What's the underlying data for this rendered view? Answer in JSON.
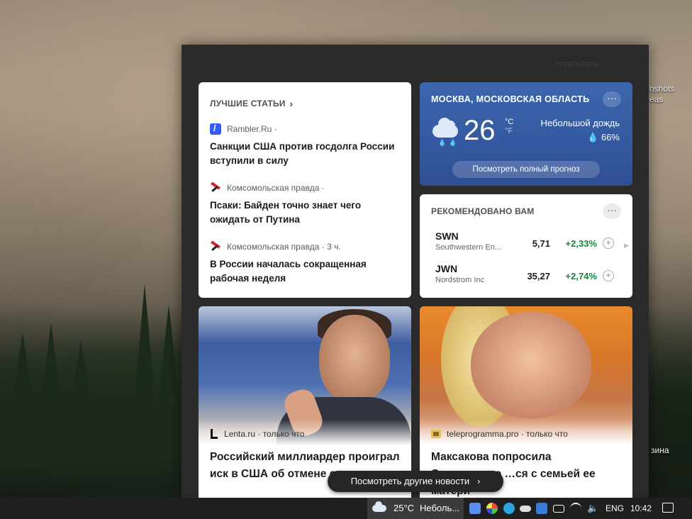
{
  "desktop": {
    "icon1_label": "nshots\neas",
    "icon2_label": "зина"
  },
  "panel": {
    "top_right_text": "Управлять"
  },
  "top_stories": {
    "title": "ЛУЧШИЕ СТАТЬИ",
    "items": [
      {
        "source": "Rambler.Ru ·",
        "headline": "Санкции США против госдолга России вступили в силу",
        "icon": "rambler-logo-icon"
      },
      {
        "source": "Комсомольская правда ·",
        "headline": "Псаки: Байден точно знает чего ожидать от Путина",
        "icon": "kp-logo-icon"
      },
      {
        "source": "Комсомольская правда · 3 ч.",
        "headline": "В России началась сокращенная рабочая неделя",
        "icon": "kp-logo-icon"
      }
    ]
  },
  "weather": {
    "location": "МОСКВА, МОСКОВСКАЯ ОБЛАСТЬ",
    "more": "···",
    "temp": "26",
    "unit_c": "°C",
    "unit_f": "°F",
    "condition": "Небольшой дождь",
    "precip": "💧 66%",
    "forecast_button": "Посмотреть полный прогноз",
    "icon": "rain-cloud-icon"
  },
  "stocks": {
    "title": "РЕКОМЕНДОВАНО ВАМ",
    "more": "···",
    "items": [
      {
        "symbol": "SWN",
        "name": "Southwestern En...",
        "price": "5,71",
        "change": "+2,33%"
      },
      {
        "symbol": "JWN",
        "name": "Nordstrom Inc",
        "price": "35,27",
        "change": "+2,74%"
      }
    ]
  },
  "news_cards": [
    {
      "source": "Lenta.ru · только что",
      "headline": "Российский миллиардер проиграл иск в США об отмене с",
      "icon": "lenta-logo-icon"
    },
    {
      "source": "teleprogramma.pro · только что",
      "headline": "Максакова попросила Садальского …ся с семьей ее матери",
      "icon": "teleprogramma-logo-icon"
    }
  ],
  "see_more_button": "Посмотреть другие новости",
  "taskbar": {
    "weather_temp": "25°C",
    "weather_cond": "Неболь...",
    "lang": "ENG",
    "time": "10:42"
  }
}
